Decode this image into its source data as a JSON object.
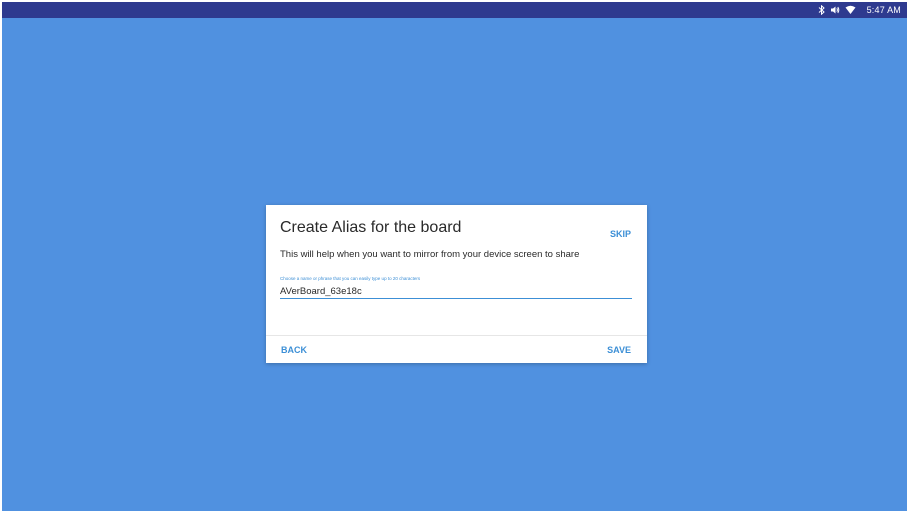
{
  "status_bar": {
    "time": "5:47 AM",
    "icons": [
      "bluetooth-icon",
      "volume-icon",
      "wifi-icon"
    ]
  },
  "dialog": {
    "title": "Create Alias for the board",
    "skip_label": "SKIP",
    "description": "This will help when you want to mirror from your device screen to share",
    "field_hint": "Choose a name or phrase that you can easily type up to 20 characters",
    "alias_value": "AVerBoard_63e18c",
    "back_label": "BACK",
    "save_label": "SAVE"
  },
  "colors": {
    "background": "#5091e0",
    "status_bar": "#2e3a8f",
    "accent": "#3c8fd6"
  }
}
